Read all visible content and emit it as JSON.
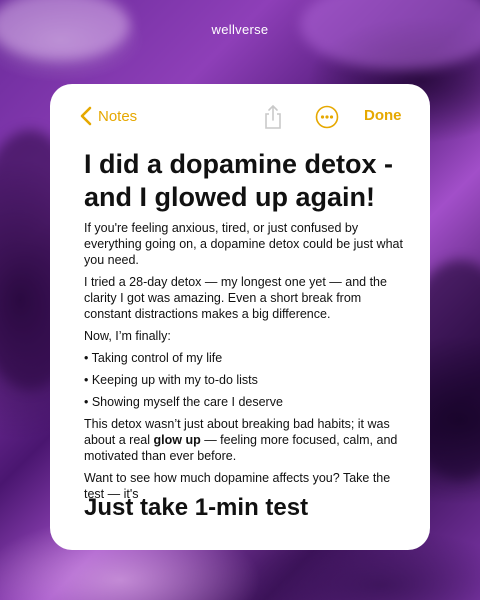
{
  "brand": "wellverse",
  "toolbar": {
    "back_label": "Notes",
    "done_label": "Done"
  },
  "note": {
    "title": "I did a dopamine detox - and I glowed up again!",
    "paragraphs": [
      "If you're feeling anxious, tired, or just confused by everything going on, a dopamine detox could be just what you need.",
      " I tried a 28-day detox — my longest one yet — and the clarity I got was amazing. Even a short break from constant distractions makes a big difference.",
      "Now, I’m finally:"
    ],
    "bullets": [
      "• Taking control of my life",
      "• Keeping up with my to-do lists",
      "• Showing myself the care I deserve"
    ],
    "p4_before": "This detox wasn’t just about breaking bad habits; it was about a real ",
    "p4_bold": "glow up",
    "p4_after": " — feeling more focused, calm, and motivated than ever before.",
    "p5": "Want to see how much dopamine affects you? Take the test — it's",
    "cta": "Just take 1-min test"
  },
  "colors": {
    "accent": "#e6a800",
    "background_purple": "#6a2a9a"
  },
  "icons": [
    "wellverse-logo",
    "chevron-left-icon",
    "share-icon",
    "more-icon"
  ]
}
